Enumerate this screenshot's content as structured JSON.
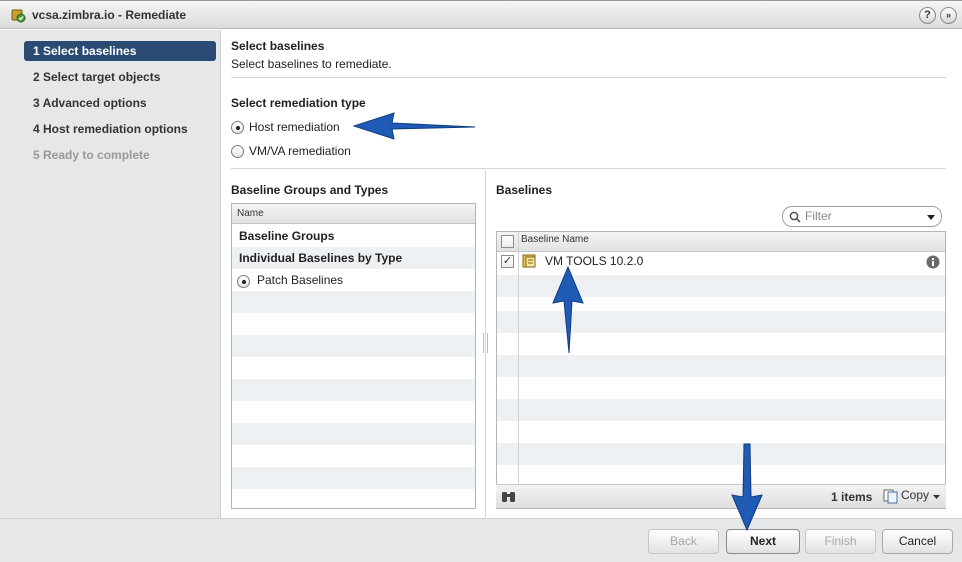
{
  "window": {
    "title": "vcsa.zimbra.io - Remediate",
    "help_glyph": "?",
    "menu_glyph": "»"
  },
  "nav": {
    "items": [
      {
        "label": "1  Select baselines",
        "state": "active"
      },
      {
        "label": "2  Select target objects",
        "state": "normal"
      },
      {
        "label": "3  Advanced options",
        "state": "normal"
      },
      {
        "label": "4  Host remediation options",
        "state": "normal"
      },
      {
        "label": "5  Ready to complete",
        "state": "disabled"
      }
    ]
  },
  "header": {
    "title": "Select baselines",
    "subtitle": "Select baselines to remediate."
  },
  "remediation": {
    "heading": "Select remediation type",
    "options": [
      {
        "label": "Host remediation",
        "selected": true
      },
      {
        "label": "VM/VA remediation",
        "selected": false
      }
    ]
  },
  "groups_panel": {
    "heading": "Baseline Groups and Types",
    "column": "Name",
    "rows": [
      {
        "label": "Baseline Groups"
      },
      {
        "label": "Individual Baselines by Type"
      },
      {
        "label": "Patch Baselines"
      }
    ]
  },
  "baselines_panel": {
    "heading": "Baselines",
    "filter_placeholder": "Filter",
    "column": "Baseline Name",
    "rows": [
      {
        "name": "VM TOOLS 10.2.0",
        "checked": true
      }
    ],
    "item_count": "1 items",
    "copy_label": "Copy"
  },
  "buttons": {
    "back": "Back",
    "next": "Next",
    "finish": "Finish",
    "cancel": "Cancel"
  },
  "colors": {
    "nav_active": "#2a4b73",
    "arrow": "#1f5bb5",
    "stripe": "#eef1f4"
  }
}
